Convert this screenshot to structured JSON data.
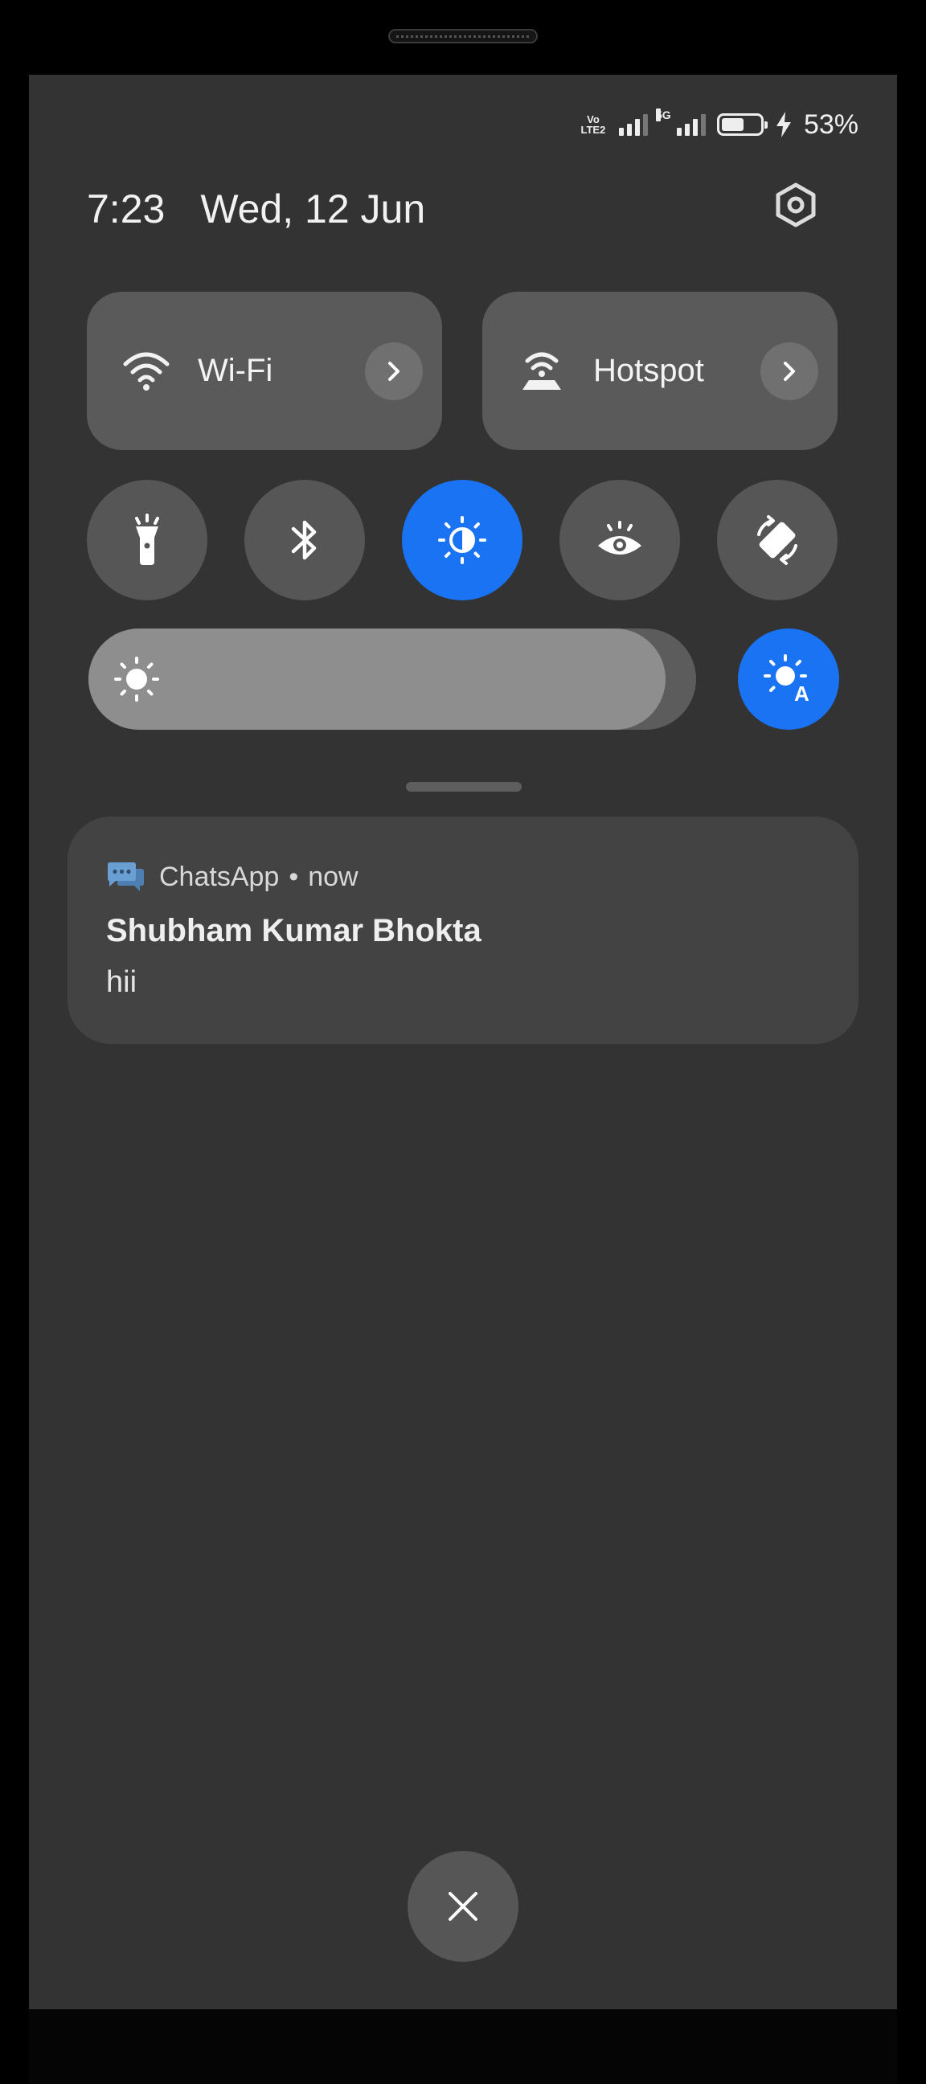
{
  "status_bar": {
    "network_tag": "VoLTE",
    "network_line1": "Vo",
    "network_line2": "LTE2",
    "second_sim_tag": "5G",
    "battery_percent": "53%",
    "battery_level": 0.53,
    "charging": true
  },
  "header": {
    "time": "7:23",
    "date": "Wed, 12 Jun",
    "settings_icon": "settings-hexagon-icon"
  },
  "tiles": [
    {
      "label": "Wi-Fi",
      "icon": "wifi-icon"
    },
    {
      "label": "Hotspot",
      "icon": "hotspot-icon"
    }
  ],
  "toggles": [
    {
      "icon": "flashlight-icon",
      "active": false
    },
    {
      "icon": "bluetooth-icon",
      "active": false
    },
    {
      "icon": "dark-mode-icon",
      "active": true
    },
    {
      "icon": "eye-comfort-icon",
      "active": false
    },
    {
      "icon": "auto-rotate-icon",
      "active": false
    }
  ],
  "brightness": {
    "level": 0.95,
    "auto_enabled": true
  },
  "notification": {
    "app": "ChatsApp",
    "separator": "•",
    "time": "now",
    "title": "Shubham Kumar Bhokta",
    "body": "hii"
  },
  "colors": {
    "accent": "#1a73f2",
    "screen_bg": "#333333",
    "tile_bg": "#5a5a5a",
    "notification_bg": "#434343",
    "chat_icon": "#6a9fd4"
  }
}
